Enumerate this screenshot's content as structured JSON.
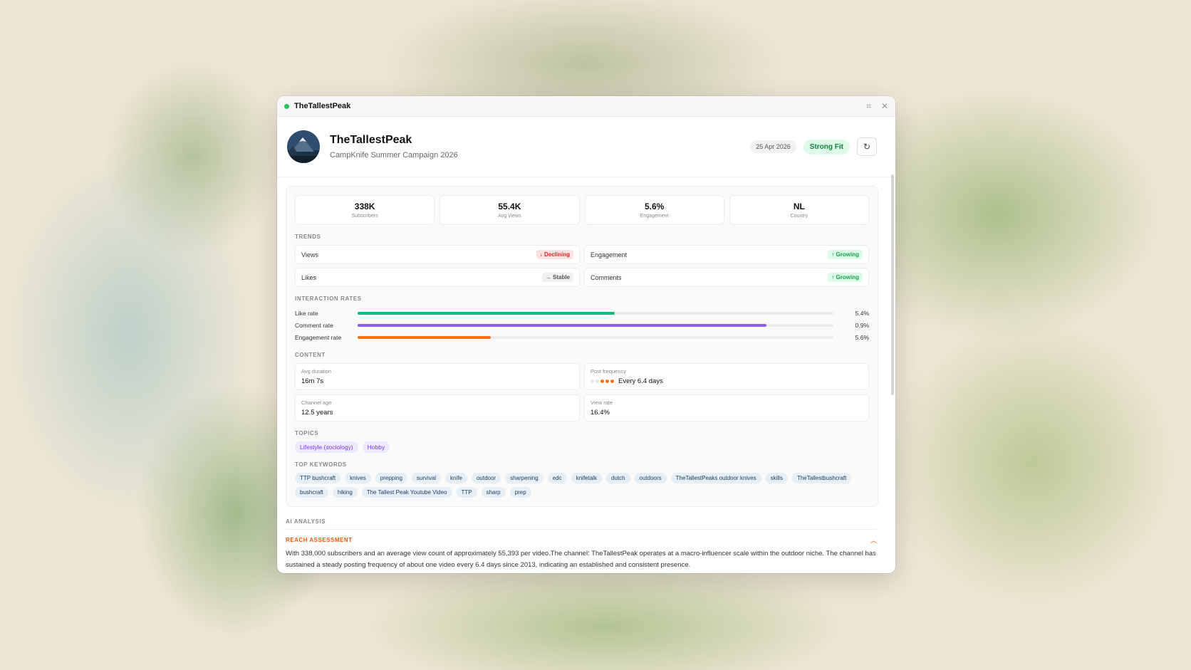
{
  "window": {
    "title": "TheTallestPeak"
  },
  "header": {
    "channel_name": "TheTallestPeak",
    "campaign": "CampKnife Summer Campaign 2026",
    "date": "25 Apr 2026",
    "fit": "Strong Fit",
    "refresh_icon": "refresh-icon"
  },
  "stats": [
    {
      "value": "338K",
      "label": "Subscribers"
    },
    {
      "value": "55.4K",
      "label": "Avg Views"
    },
    {
      "value": "5.6%",
      "label": "Engagement"
    },
    {
      "value": "NL",
      "label": "Country"
    }
  ],
  "sections": {
    "trends": "TRENDS",
    "interaction": "INTERACTION RATES",
    "content": "CONTENT",
    "topics": "TOPICS",
    "keywords": "TOP KEYWORDS"
  },
  "trends": [
    {
      "label": "Views",
      "badge": "↓ Declining",
      "status": "declining"
    },
    {
      "label": "Engagement",
      "badge": "↑ Growing",
      "status": "growing"
    },
    {
      "label": "Likes",
      "badge": "→ Stable",
      "status": "stable"
    },
    {
      "label": "Comments",
      "badge": "↑ Growing",
      "status": "growing"
    }
  ],
  "rates": [
    {
      "label": "Like rate",
      "value": "5.4%",
      "fill": 0.54,
      "color": "#10b981"
    },
    {
      "label": "Comment rate",
      "value": "0.9%",
      "fill": 0.86,
      "color": "#8b5cf6"
    },
    {
      "label": "Engagement rate",
      "value": "5.6%",
      "fill": 0.28,
      "color": "#f97316"
    }
  ],
  "content": {
    "avg_duration_label": "Avg duration",
    "avg_duration": "16m 7s",
    "post_frequency_label": "Post frequency",
    "post_frequency": "Every 6.4 days",
    "post_frequency_dots": [
      "#e5e7eb",
      "#e5e7eb",
      "#f97316",
      "#f97316",
      "#f97316"
    ],
    "channel_age_label": "Channel age",
    "channel_age": "12.5 years",
    "view_rate_label": "View rate",
    "view_rate": "16.4%"
  },
  "topics": [
    "Lifestyle (sociology)",
    "Hobby"
  ],
  "keywords": [
    "TTP bushcraft",
    "knives",
    "prepping",
    "survival",
    "knife",
    "outdoor",
    "sharpening",
    "edc",
    "knifetalk",
    "dutch",
    "outdoors",
    "TheTallestPeaks outdoor knives",
    "skills",
    "TheTallestbushcraft",
    "bushcraft",
    "hiking",
    "The Tallest Peak Youtube Video",
    "TTP",
    "sharp",
    "prep"
  ],
  "ai": {
    "title": "AI ANALYSIS",
    "reach_title": "REACH ASSESSMENT",
    "reach_text": "With 338,000 subscribers and an average view count of approximately 55,393 per video.The channel: TheTallestPeak operates at a macro-influencer scale within the outdoor niche. The channel has sustained a steady posting frequency of about one video every 6.4 days since 2013, indicating an established and consistent presence."
  }
}
